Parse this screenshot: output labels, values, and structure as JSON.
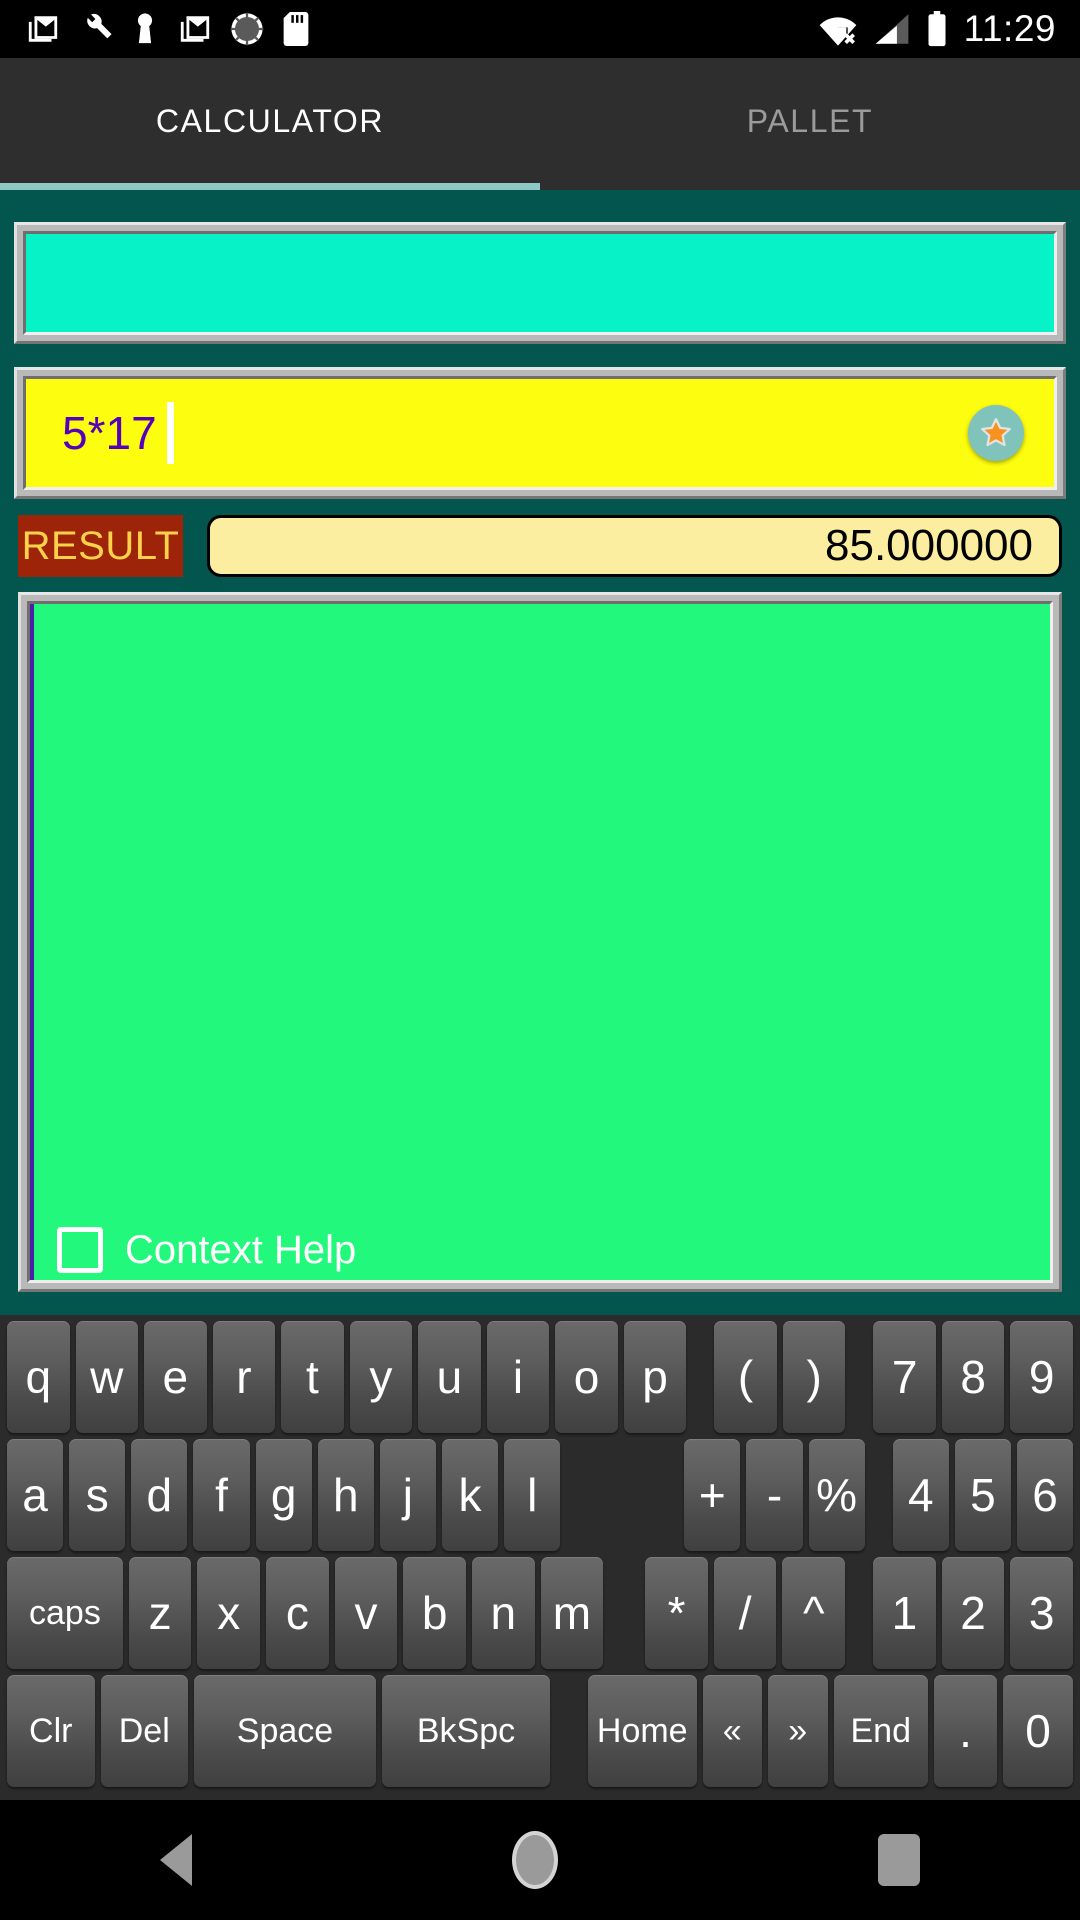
{
  "statusbar": {
    "time": "11:29",
    "left_icons": [
      "gmail-icon",
      "wrench-icon",
      "keyhole-icon",
      "gmail-icon",
      "sync-spinner-icon",
      "sdcard-icon"
    ],
    "right_icons": [
      "wifi-no-connection-icon",
      "cellular-signal-icon",
      "battery-full-icon"
    ]
  },
  "tabs": {
    "calculator_label": "CALCULATOR",
    "pallet_label": "PALLET",
    "active": "CALCULATOR",
    "underline_color": "#8ecac3"
  },
  "display": {
    "top_panel_value": "",
    "top_panel_color": "#07f2c7"
  },
  "input": {
    "expression": "5*17",
    "background_color": "#fdfd10",
    "text_color": "#5500bb",
    "favorite_button": "star-icon"
  },
  "result": {
    "label": "RESULT",
    "value": "85.000000",
    "label_bg": "#9e2409",
    "label_fg": "#ffd24a",
    "value_bg": "#fbeea0"
  },
  "output": {
    "text": "",
    "background_color": "#22f87c"
  },
  "context_help": {
    "label": "Context Help",
    "checked": false
  },
  "keyboard": {
    "row1": [
      "q",
      "w",
      "e",
      "r",
      "t",
      "y",
      "u",
      "i",
      "o",
      "p"
    ],
    "row1_ops": [
      "(",
      ")"
    ],
    "row1_nums": [
      "7",
      "8",
      "9"
    ],
    "row2": [
      "a",
      "s",
      "d",
      "f",
      "g",
      "h",
      "j",
      "k",
      "l"
    ],
    "row2_ops": [
      "+",
      "-",
      "%"
    ],
    "row2_nums": [
      "4",
      "5",
      "6"
    ],
    "row3_caps": "caps",
    "row3": [
      "z",
      "x",
      "c",
      "v",
      "b",
      "n",
      "m"
    ],
    "row3_ops": [
      "*",
      "/",
      "^"
    ],
    "row3_nums": [
      "1",
      "2",
      "3"
    ],
    "row4": [
      "Clr",
      "Del",
      "Space",
      "BkSpc"
    ],
    "row4_nav": [
      "Home",
      "«",
      "»",
      "End"
    ],
    "row4_nums": [
      ".",
      "0"
    ]
  },
  "navbar": {
    "back": "back-triangle-icon",
    "home": "home-circle-icon",
    "recents": "recents-square-icon"
  }
}
